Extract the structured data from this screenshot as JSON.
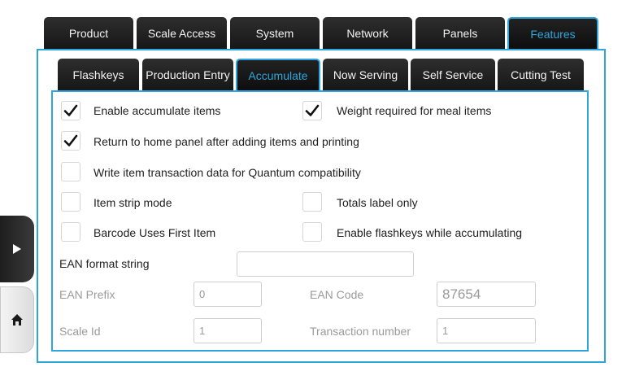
{
  "main_tabs": [
    {
      "label": "Product",
      "active": false
    },
    {
      "label": "Scale Access",
      "active": false
    },
    {
      "label": "System",
      "active": false
    },
    {
      "label": "Network",
      "active": false
    },
    {
      "label": "Panels",
      "active": false
    },
    {
      "label": "Features",
      "active": true
    }
  ],
  "sub_tabs": [
    {
      "label": "Flashkeys",
      "active": false
    },
    {
      "label": "Production Entry",
      "active": false
    },
    {
      "label": "Accumulate",
      "active": true
    },
    {
      "label": "Now Serving",
      "active": false
    },
    {
      "label": "Self Service",
      "active": false
    },
    {
      "label": "Cutting Test",
      "active": false
    }
  ],
  "options": {
    "enable_accumulate": {
      "label": "Enable accumulate items",
      "checked": true
    },
    "weight_required": {
      "label": "Weight required for meal items",
      "checked": true
    },
    "return_home": {
      "label": "Return to home panel after adding items and printing",
      "checked": true
    },
    "write_quantum": {
      "label": "Write item transaction data for Quantum compatibility",
      "checked": false
    },
    "item_strip": {
      "label": "Item strip mode",
      "checked": false
    },
    "totals_label": {
      "label": "Totals label only",
      "checked": false
    },
    "barcode_first": {
      "label": "Barcode Uses First Item",
      "checked": false
    },
    "flashkeys_accum": {
      "label": "Enable flashkeys while accumulating",
      "checked": false
    }
  },
  "fields": {
    "ean_format": {
      "label": "EAN format string",
      "value": ""
    },
    "ean_prefix": {
      "label": "EAN Prefix",
      "value": "0"
    },
    "ean_code": {
      "label": "EAN Code",
      "value": "87654"
    },
    "scale_id": {
      "label": "Scale Id",
      "value": "1"
    },
    "transaction_number": {
      "label": "Transaction number",
      "value": "1"
    }
  },
  "sidebar": {
    "expand_icon": "play-arrow-icon",
    "home_icon": "home-icon"
  },
  "colors": {
    "accent": "#2ea6dd",
    "tab_bg": "#1c1c1c",
    "disabled_text": "#9a9a9a"
  }
}
